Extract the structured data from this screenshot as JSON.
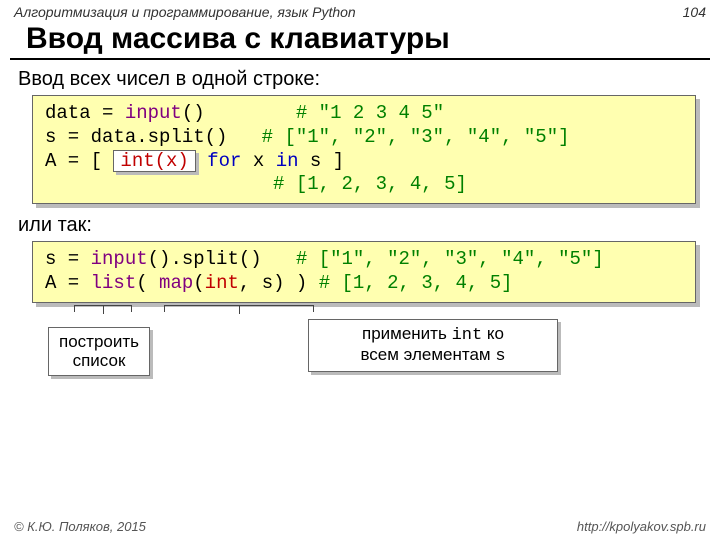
{
  "header": {
    "course": "Алгоритмизация и программирование, язык Python",
    "page": "104"
  },
  "title": "Ввод массива с клавиатуры",
  "lead1": "Ввод всех чисел в одной строке:",
  "code1": {
    "l1a": "data",
    "l1b": " = ",
    "l1c": "input",
    "l1d": "()        ",
    "l1e": "# \"1 2 3 4 5\"",
    "l2a": "s",
    "l2b": " = ",
    "l2c": "data.split()   ",
    "l2d": "# [\"1\", \"2\", \"3\", \"4\", \"5\"]",
    "l3a": "A",
    "l3b": " = [ ",
    "l3hi": "int(x)",
    "l3c": " ",
    "l3d": "for",
    "l3e": " x ",
    "l3f": "in",
    "l3g": " s ]",
    "l4a": "                    ",
    "l4b": "# [1, 2, 3, 4, 5]"
  },
  "or": "или так:",
  "code2": {
    "l1a": "s",
    "l1b": " = ",
    "l1c": "input",
    "l1d": "().split()   ",
    "l1e": "# [\"1\", \"2\", \"3\", \"4\", \"5\"]",
    "l2a": "A",
    "l2b": " = ",
    "l2c": "list",
    "l2d": "( ",
    "l2e": "map",
    "l2f": "(",
    "l2g": "int",
    "l2h": ", s) ) ",
    "l2i": "# [1, 2, 3, 4, 5]"
  },
  "callouts": {
    "left_l1": "построить",
    "left_l2": "список",
    "right_l1": "применить ",
    "right_code": "int",
    "right_l2": " ко",
    "right_l3": "всем элементам ",
    "right_code2": "s"
  },
  "footer": {
    "copyright": "© К.Ю. Поляков, 2015",
    "url": "http://kpolyakov.spb.ru"
  }
}
